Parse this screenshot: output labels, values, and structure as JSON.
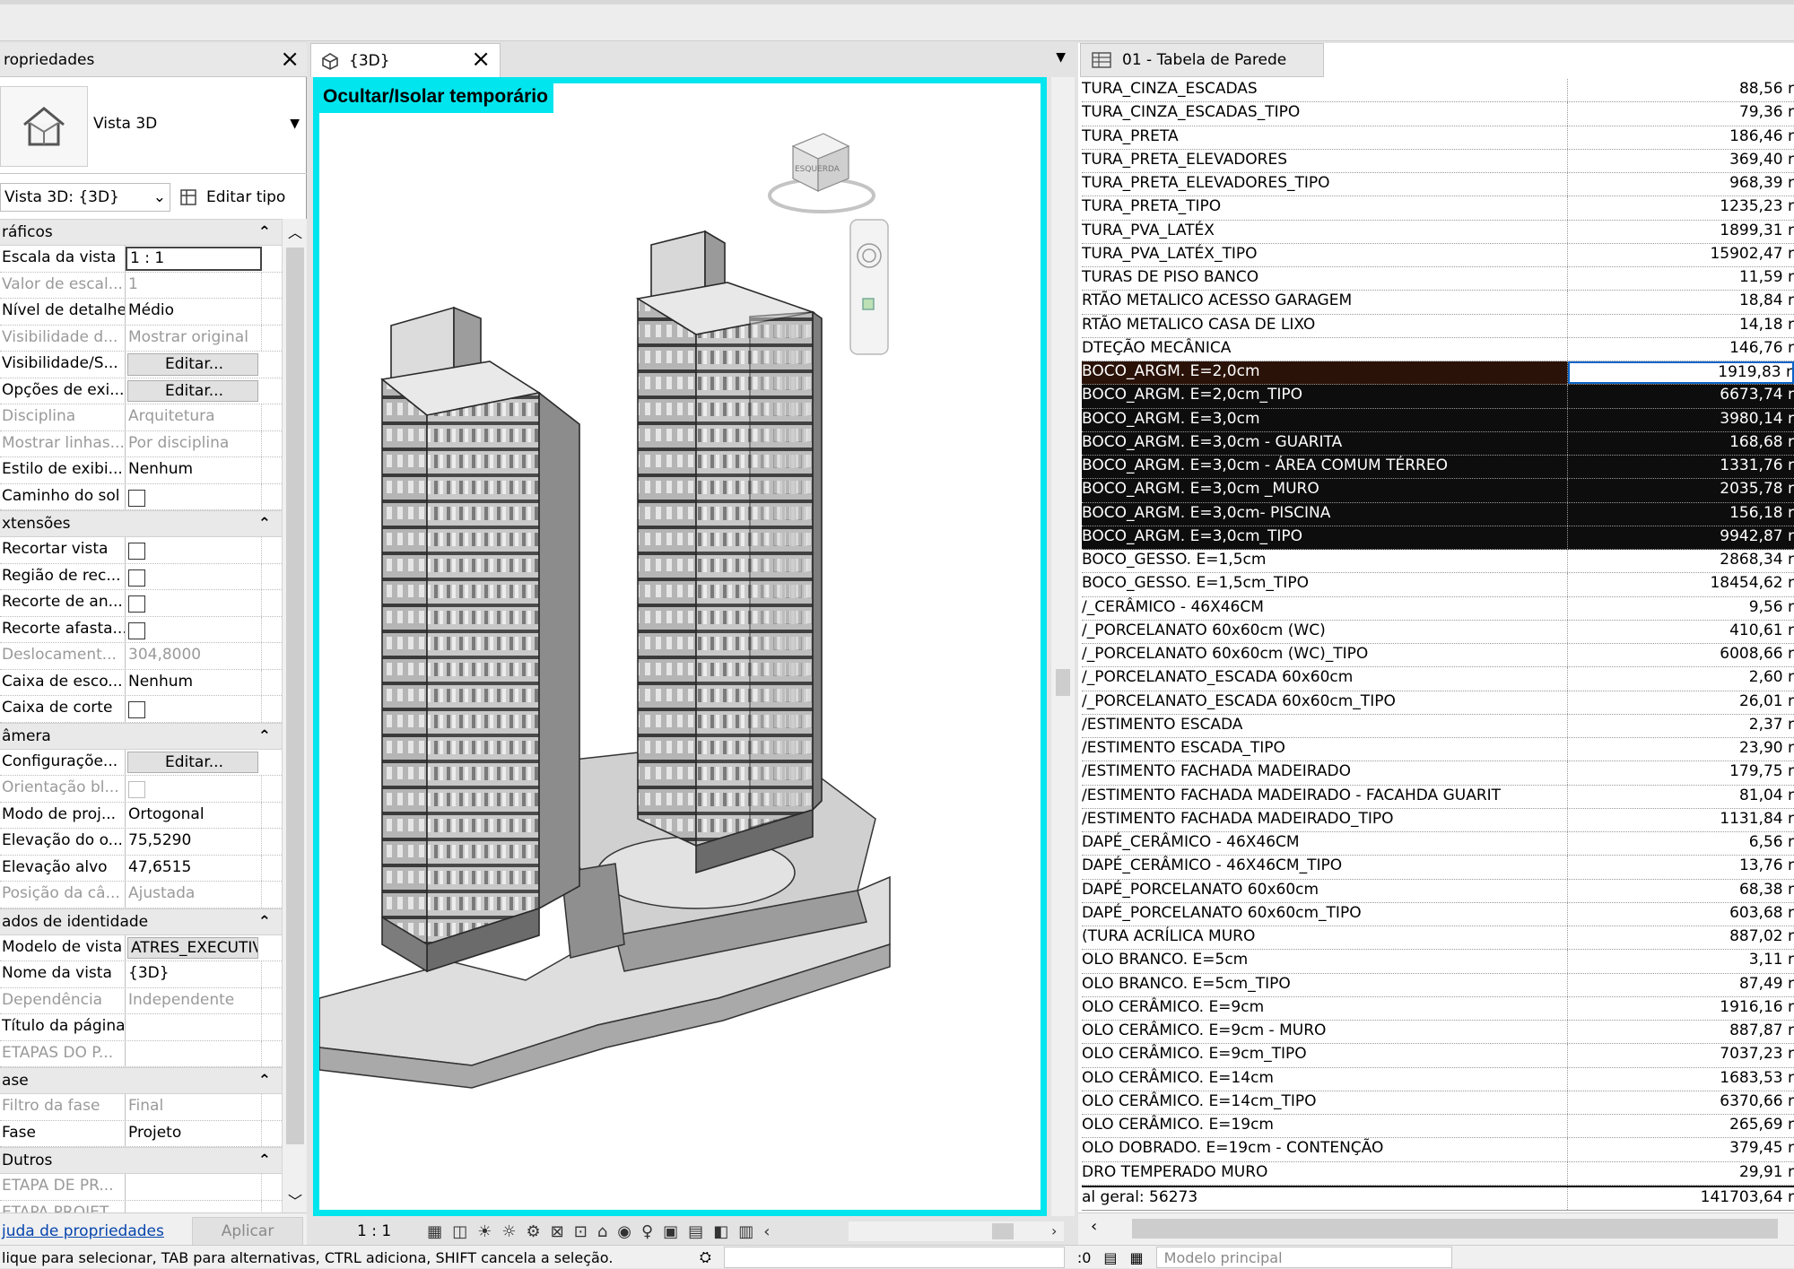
{
  "properties": {
    "title": "ropriedades",
    "type_name": "Vista 3D",
    "instance_selector": "Vista 3D: {3D}",
    "edit_type": "Editar tipo",
    "sections": [
      {
        "title": "ráficos",
        "rows": [
          {
            "k": "Escala da vista",
            "v": "1 : 1",
            "style": "box"
          },
          {
            "k": "Valor de escal...",
            "v": "1",
            "style": "dis"
          },
          {
            "k": "Nível de detalhe",
            "v": "Médio"
          },
          {
            "k": "Visibilidade d...",
            "v": "Mostrar original",
            "style": "dis"
          },
          {
            "k": "Visibilidade/S...",
            "v": "Editar...",
            "style": "btn"
          },
          {
            "k": "Opções de exi...",
            "v": "Editar...",
            "style": "btn"
          },
          {
            "k": "Disciplina",
            "v": "Arquitetura",
            "style": "dis"
          },
          {
            "k": "Mostrar linhas...",
            "v": "Por disciplina",
            "style": "dis"
          },
          {
            "k": "Estilo de exibi...",
            "v": "Nenhum"
          },
          {
            "k": "Caminho do sol",
            "v": "",
            "style": "cb"
          }
        ]
      },
      {
        "title": "xtensões",
        "rows": [
          {
            "k": "Recortar vista",
            "v": "",
            "style": "cb"
          },
          {
            "k": "Região de rec...",
            "v": "",
            "style": "cb"
          },
          {
            "k": "Recorte de an...",
            "v": "",
            "style": "cb"
          },
          {
            "k": "Recorte afasta...",
            "v": "",
            "style": "cb"
          },
          {
            "k": "Deslocament...",
            "v": "304,8000",
            "style": "dis"
          },
          {
            "k": "Caixa de esco...",
            "v": "Nenhum"
          },
          {
            "k": "Caixa de corte",
            "v": "",
            "style": "cb"
          }
        ]
      },
      {
        "title": "âmera",
        "rows": [
          {
            "k": "Configuraçõe...",
            "v": "Editar...",
            "style": "btn"
          },
          {
            "k": "Orientação bl...",
            "v": "",
            "style": "cbdis"
          },
          {
            "k": "Modo de proj...",
            "v": "Ortogonal"
          },
          {
            "k": "Elevação do o...",
            "v": "75,5290"
          },
          {
            "k": "Elevação alvo",
            "v": "47,6515"
          },
          {
            "k": "Posição da câ...",
            "v": "Ajustada",
            "style": "dis"
          }
        ]
      },
      {
        "title": "ados de identidade",
        "rows": [
          {
            "k": "Modelo de vista",
            "v": "ATRES_EXECUTIV",
            "style": "btn"
          },
          {
            "k": "Nome da vista",
            "v": "{3D}"
          },
          {
            "k": "Dependência",
            "v": "Independente",
            "style": "dis"
          },
          {
            "k": "Título da página",
            "v": ""
          },
          {
            "k": "ETAPAS DO P...",
            "v": "",
            "style": "dis"
          }
        ]
      },
      {
        "title": "ase",
        "rows": [
          {
            "k": "Filtro da fase",
            "v": "Final",
            "style": "dis"
          },
          {
            "k": "Fase",
            "v": "Projeto"
          }
        ]
      },
      {
        "title": "Dutros",
        "rows": [
          {
            "k": "ETAPA DE PR...",
            "v": "",
            "style": "dis"
          },
          {
            "k": "ETAPA PROJET...",
            "v": "",
            "style": "dis"
          }
        ]
      }
    ],
    "help_link": "juda de propriedades",
    "apply": "Aplicar"
  },
  "view3d": {
    "tab": "{3D}",
    "banner": "Ocultar/Isolar temporário",
    "viewcube_label": "ESQUERDA",
    "scale": "1 : 1"
  },
  "schedule": {
    "tab": "01 - Tabela de Parede",
    "rows": [
      {
        "n": "TURA_CINZA_ESCADAS",
        "a": "88,56 r"
      },
      {
        "n": "TURA_CINZA_ESCADAS_TIPO",
        "a": "79,36 r"
      },
      {
        "n": "TURA_PRETA",
        "a": "186,46 r"
      },
      {
        "n": "TURA_PRETA_ELEVADORES",
        "a": "369,40 r"
      },
      {
        "n": "TURA_PRETA_ELEVADORES_TIPO",
        "a": "968,39 r"
      },
      {
        "n": "TURA_PRETA_TIPO",
        "a": "1235,23 r"
      },
      {
        "n": "TURA_PVA_LATÉX",
        "a": "1899,31 r"
      },
      {
        "n": "TURA_PVA_LATÉX_TIPO",
        "a": "15902,47 r"
      },
      {
        "n": "TURAS DE PISO BANCO",
        "a": "11,59 r"
      },
      {
        "n": "RTÃO METALICO ACESSO GARAGEM",
        "a": "18,84 r"
      },
      {
        "n": "RTÃO METALICO CASA DE LIXO",
        "a": "14,18 r"
      },
      {
        "n": "DTEÇÃO MECÂNICA",
        "a": "146,76 r"
      },
      {
        "n": "BOCO_ARGM. E=2,0cm",
        "a": "1919,83 r",
        "sel": "first"
      },
      {
        "n": "BOCO_ARGM. E=2,0cm_TIPO",
        "a": "6673,74 r",
        "sel": "sel"
      },
      {
        "n": "BOCO_ARGM. E=3,0cm",
        "a": "3980,14 r",
        "sel": "sel"
      },
      {
        "n": "BOCO_ARGM. E=3,0cm - GUARITA",
        "a": "168,68 r",
        "sel": "sel"
      },
      {
        "n": "BOCO_ARGM. E=3,0cm - ÁREA COMUM TÉRREO",
        "a": "1331,76 r",
        "sel": "sel"
      },
      {
        "n": "BOCO_ARGM. E=3,0cm _MURO",
        "a": "2035,78 r",
        "sel": "sel"
      },
      {
        "n": "BOCO_ARGM. E=3,0cm- PISCINA",
        "a": "156,18 r",
        "sel": "sel"
      },
      {
        "n": "BOCO_ARGM. E=3,0cm_TIPO",
        "a": "9942,87 r",
        "sel": "sel"
      },
      {
        "n": "BOCO_GESSO. E=1,5cm",
        "a": "2868,34 r"
      },
      {
        "n": "BOCO_GESSO. E=1,5cm_TIPO",
        "a": "18454,62 r"
      },
      {
        "n": "/_CERÂMICO - 46X46CM",
        "a": "9,56 r"
      },
      {
        "n": "/_PORCELANATO 60x60cm (WC)",
        "a": "410,61 r"
      },
      {
        "n": "/_PORCELANATO 60x60cm (WC)_TIPO",
        "a": "6008,66 r"
      },
      {
        "n": "/_PORCELANATO_ESCADA 60x60cm",
        "a": "2,60 r"
      },
      {
        "n": "/_PORCELANATO_ESCADA 60x60cm_TIPO",
        "a": "26,01 r"
      },
      {
        "n": "/ESTIMENTO ESCADA",
        "a": "2,37 r"
      },
      {
        "n": "/ESTIMENTO ESCADA_TIPO",
        "a": "23,90 r"
      },
      {
        "n": "/ESTIMENTO FACHADA MADEIRADO",
        "a": "179,75 r"
      },
      {
        "n": "/ESTIMENTO FACHADA MADEIRADO - FACAHDA GUARIT",
        "a": "81,04 r"
      },
      {
        "n": "/ESTIMENTO FACHADA MADEIRADO_TIPO",
        "a": "1131,84 r"
      },
      {
        "n": "DAPÉ_CERÂMICO - 46X46CM",
        "a": "6,56 r"
      },
      {
        "n": "DAPÉ_CERÂMICO - 46X46CM_TIPO",
        "a": "13,76 r"
      },
      {
        "n": "DAPÉ_PORCELANATO 60x60cm",
        "a": "68,38 r"
      },
      {
        "n": "DAPÉ_PORCELANATO 60x60cm_TIPO",
        "a": "603,68 r"
      },
      {
        "n": "(TURA ACRÍLICA MURO",
        "a": "887,02 r"
      },
      {
        "n": "OLO BRANCO. E=5cm",
        "a": "3,11 r"
      },
      {
        "n": "OLO BRANCO. E=5cm_TIPO",
        "a": "87,49 r"
      },
      {
        "n": "OLO CERÂMICO. E=9cm",
        "a": "1916,16 r"
      },
      {
        "n": "OLO CERÂMICO. E=9cm - MURO",
        "a": "887,87 r"
      },
      {
        "n": "OLO CERÂMICO. E=9cm_TIPO",
        "a": "7037,23 r"
      },
      {
        "n": "OLO CERÂMICO. E=14cm",
        "a": "1683,53 r"
      },
      {
        "n": "OLO CERÂMICO. E=14cm_TIPO",
        "a": "6370,66 r"
      },
      {
        "n": "OLO CERÂMICO. E=19cm",
        "a": "265,69 r"
      },
      {
        "n": "OLO DOBRADO. E=19cm - CONTENÇÃO",
        "a": "379,45 r"
      },
      {
        "n": "DRO TEMPERADO MURO",
        "a": "29,91 r"
      }
    ],
    "total_label": "al geral: 56273",
    "total_value": "141703,64 r"
  },
  "status": {
    "message": "lique para selecionar, TAB para alternativas, CTRL adiciona, SHIFT cancela a seleção.",
    "count": ":0",
    "model": "Modelo principal"
  }
}
